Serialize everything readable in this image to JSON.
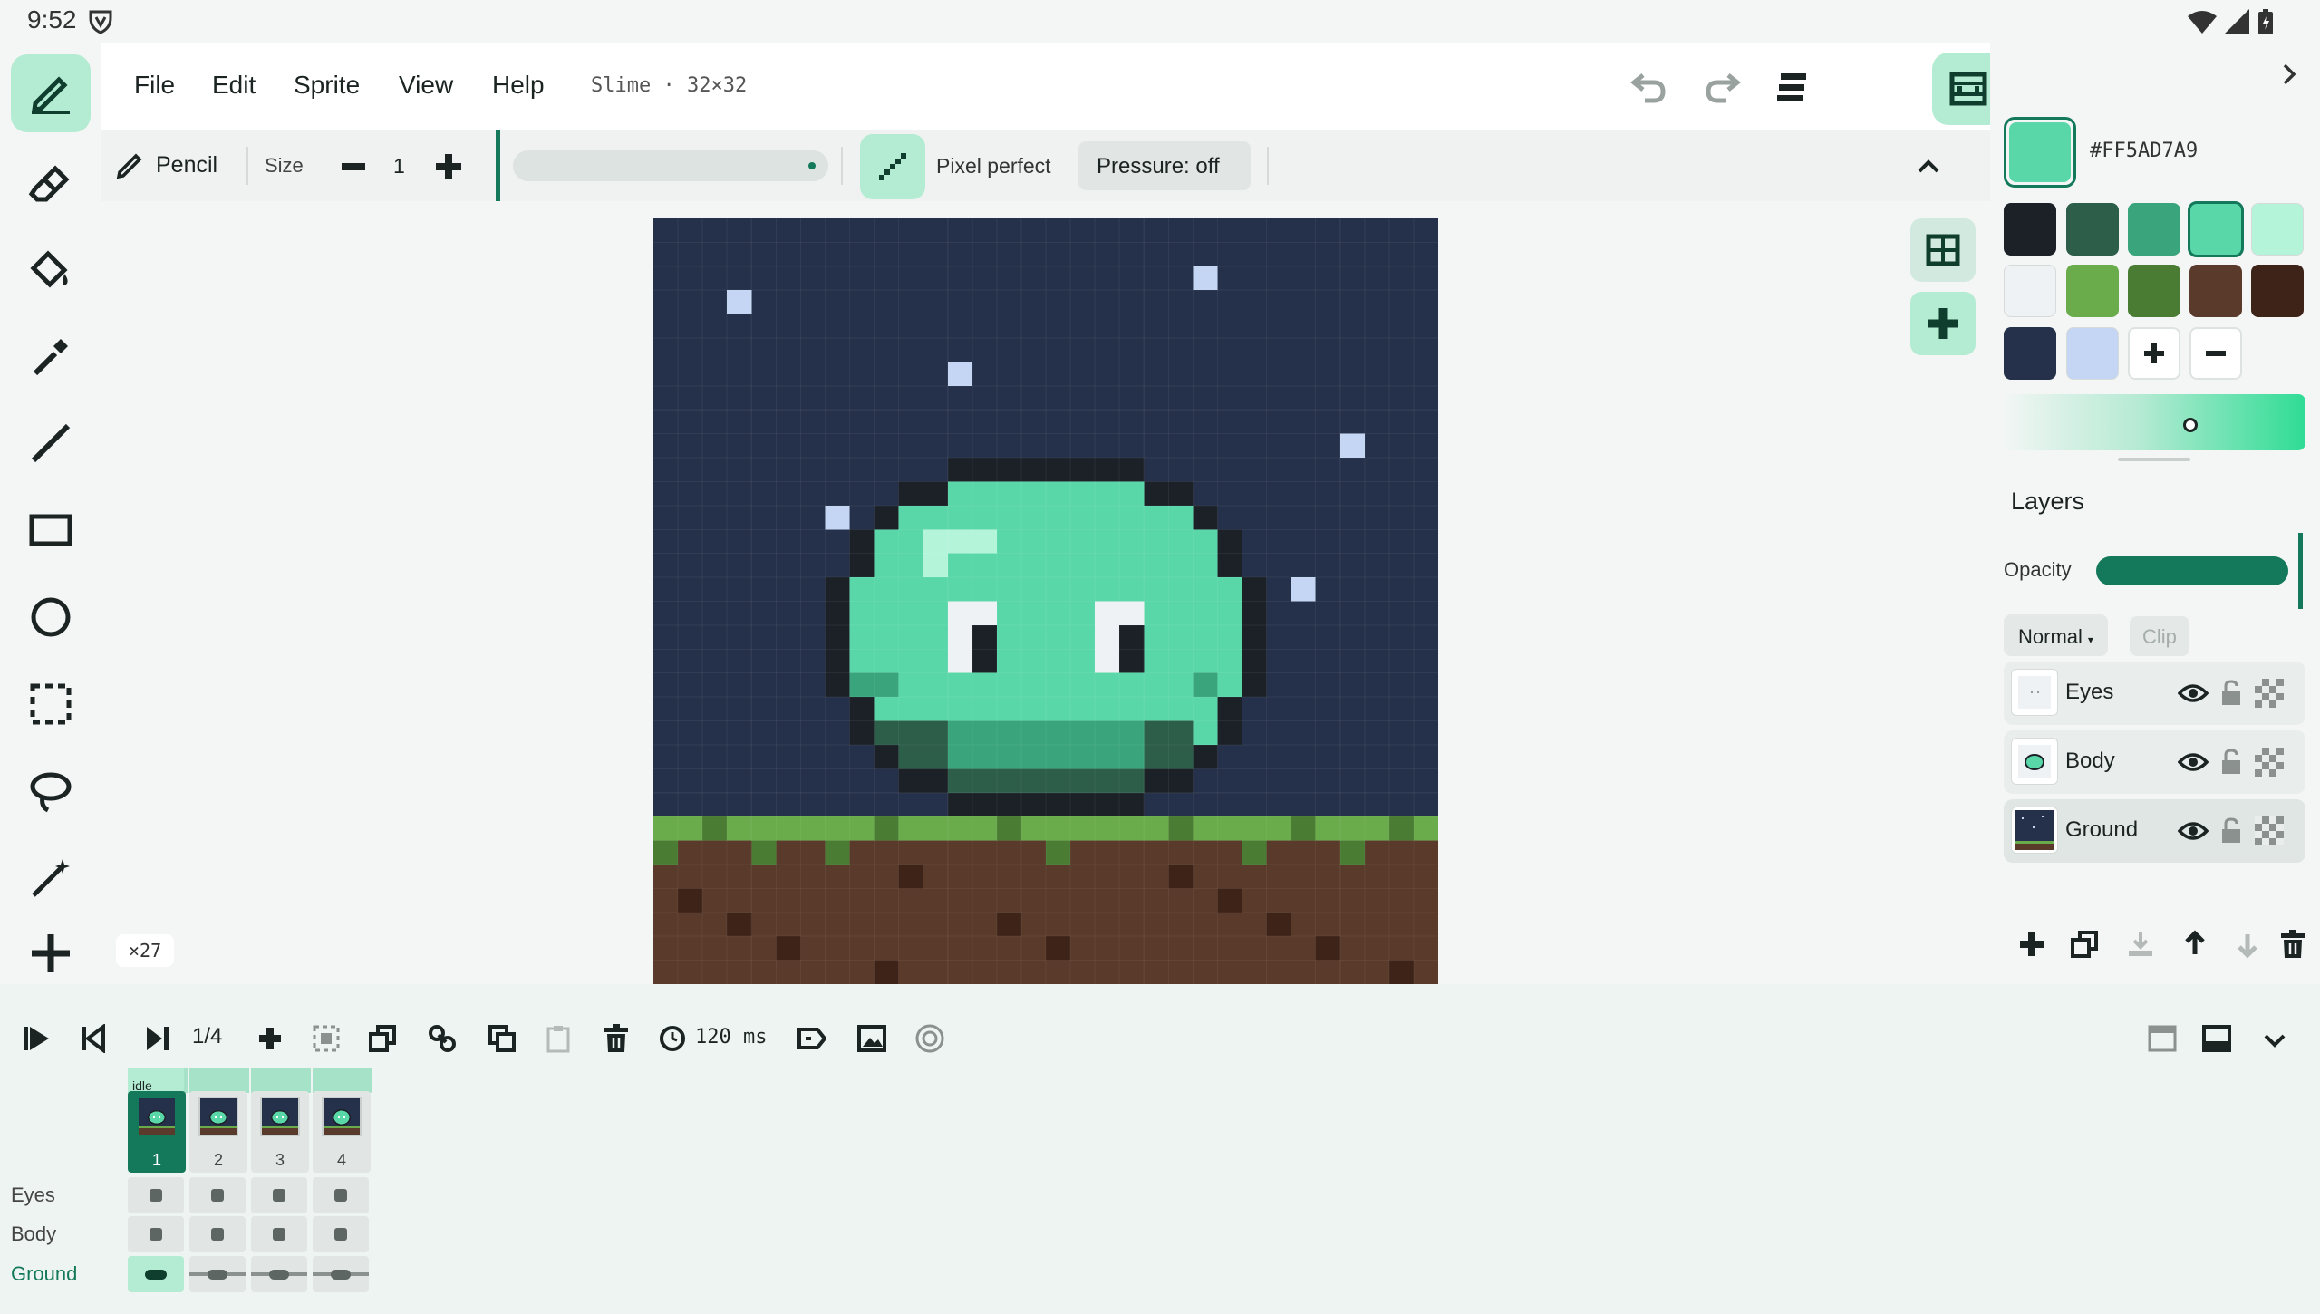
{
  "status": {
    "time": "9:52"
  },
  "menu": {
    "items": [
      "File",
      "Edit",
      "Sprite",
      "View",
      "Help"
    ],
    "doc_title": "Slime · 32×32"
  },
  "tool_options": {
    "tool_name": "Pencil",
    "size_label": "Size",
    "size_value": "1",
    "pixel_perfect_label": "Pixel perfect",
    "pressure_label": "Pressure: off"
  },
  "canvas": {
    "zoom_label": "×27"
  },
  "color": {
    "current_hex": "#FF5AD7A9",
    "current": "#5ad7a9",
    "palette": [
      "#1c2128",
      "#2c5e4a",
      "#3aa57d",
      "#5ad7a9",
      "#b4f5da",
      "#eef2f5",
      "#6aac4b",
      "#4a7d33",
      "#5a3a2a",
      "#3e2418",
      "#25304a",
      "#c4d6f4"
    ]
  },
  "layers": {
    "title": "Layers",
    "opacity_label": "Opacity",
    "opacity": 1.0,
    "blend_mode": "Normal",
    "clip_label": "Clip",
    "items": [
      {
        "name": "Eyes"
      },
      {
        "name": "Body"
      },
      {
        "name": "Ground"
      }
    ]
  },
  "timeline": {
    "frame_counter": "1/4",
    "frame_duration": "120 ms",
    "tag_label": "idle",
    "frames": [
      "1",
      "2",
      "3",
      "4"
    ],
    "layer_names": [
      "Eyes",
      "Body",
      "Ground"
    ]
  },
  "accent": "#13795a"
}
